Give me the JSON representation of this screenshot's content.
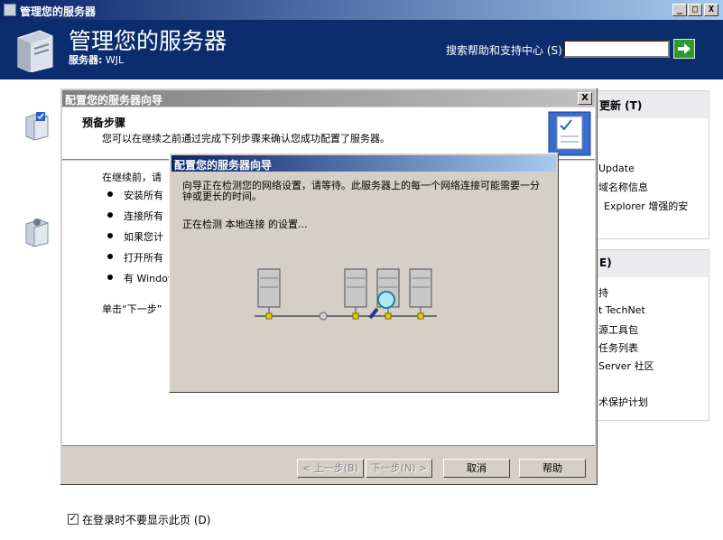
{
  "main_window": {
    "title": "管理您的服务器",
    "controls": {
      "minimize": "_",
      "maximize": "□",
      "close": "X"
    }
  },
  "header": {
    "title": "管理您的服务器",
    "server_label": "服务器:",
    "server_name": "WJL",
    "search_label": "搜索帮助和支持中心 (S)",
    "search_value": "",
    "go_icon": "arrow-right-icon"
  },
  "right_panels": {
    "panel1_head": "更新 (T)",
    "panel1_items": [
      "Update",
      "域名称信息",
      "Explorer 增强的安"
    ],
    "panel2_head": "E)",
    "panel2_items": [
      "持",
      "t TechNet",
      "源工具包",
      "任务列表",
      "Server 社区",
      "术保护计划"
    ]
  },
  "bottom": {
    "checkbox_checked": true,
    "checkbox_mark": "✓",
    "checkbox_label": "在登录时不要显示此页 (D)"
  },
  "wizard": {
    "title": "配置您的服务器向导",
    "close": "X",
    "heading": "预备步骤",
    "subheading": "您可以在继续之前通过完成下列步骤来确认您成功配置了服务器。",
    "intro": "在继续前，请",
    "bullets": [
      "安装所有",
      "连接所有",
      "如果您计",
      "打开所有",
      "有 Window"
    ],
    "footer_text": "单击“下一步”",
    "buttons": {
      "back": "< 上一步(B)",
      "next": "下一步(N) >",
      "cancel": "取消",
      "help": "帮助"
    }
  },
  "progress_dialog": {
    "title": "配置您的服务器向导",
    "message": "向导正在检测您的网络设置，请等待。此服务器上的每一个网络连接可能需要一分钟或更长的时间。",
    "status": "正在检测 本地连接 的设置..."
  }
}
